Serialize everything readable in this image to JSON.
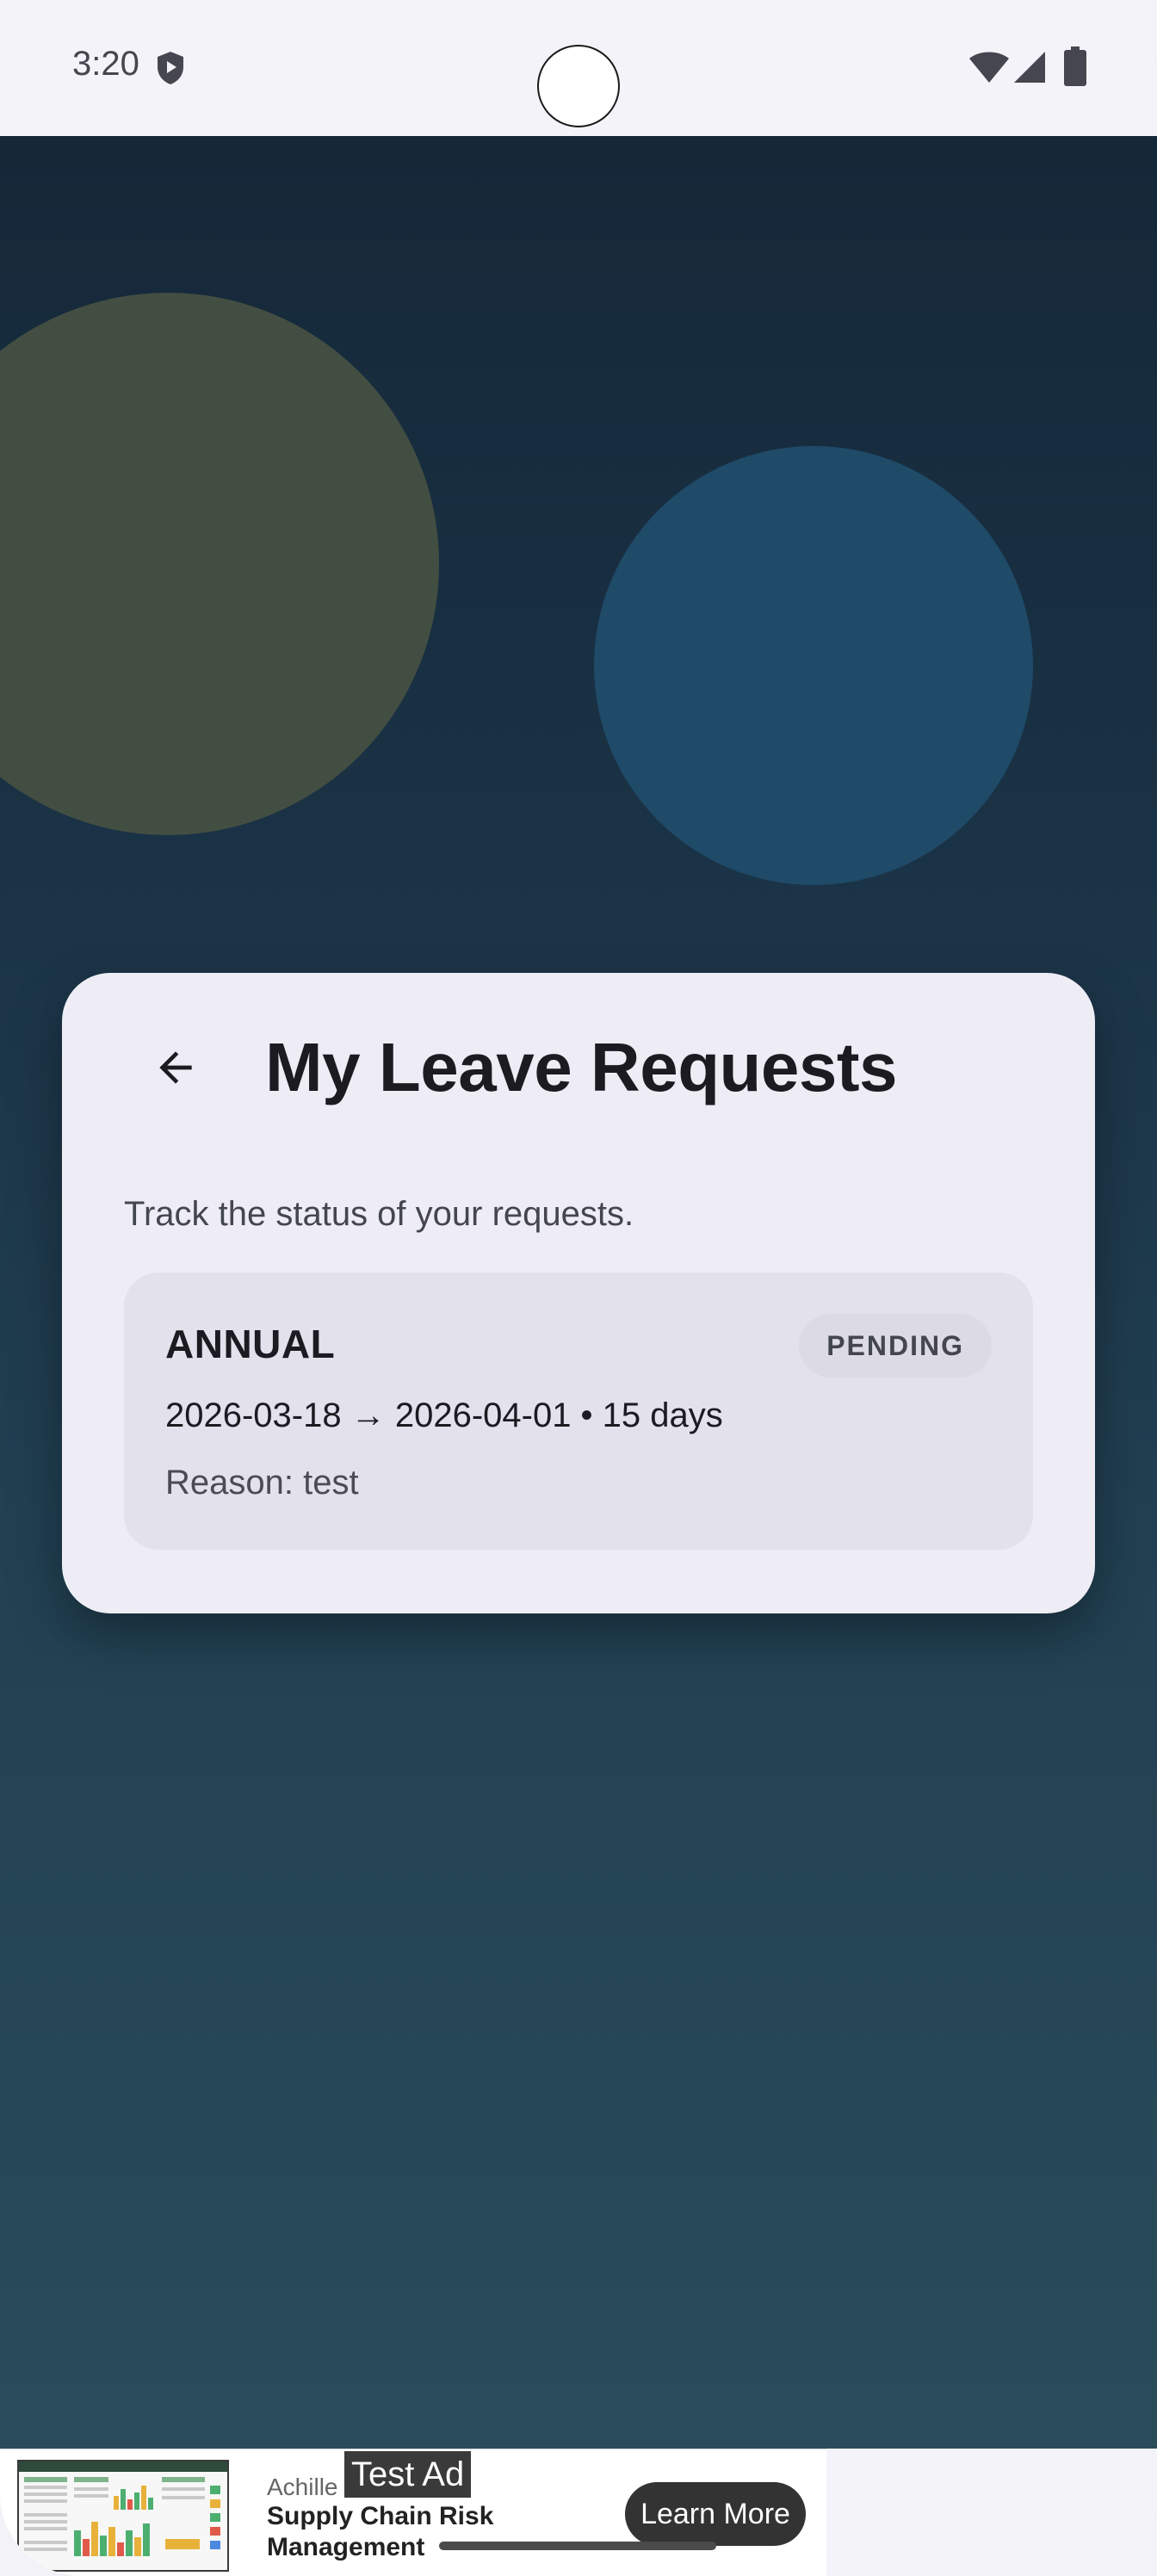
{
  "status_bar": {
    "time": "3:20"
  },
  "screen": {
    "title": "My Leave Requests",
    "subtitle": "Track the status of your requests.",
    "back_icon": "arrow-back-icon"
  },
  "requests": [
    {
      "type": "ANNUAL",
      "status": "PENDING",
      "dates": "2026-03-18 → 2026-04-01 • 15 days",
      "reason": "Reason: test"
    }
  ],
  "ad": {
    "advertiser": "Achille",
    "test_tag": "Test Ad",
    "headline": "Supply Chain Risk Management",
    "cta": "Learn More"
  },
  "colors": {
    "background_top": "#152838",
    "background_bottom": "#2a4c5a",
    "card": "#eeedf5",
    "request_card": "#e3e2ec",
    "blob_olive": "#434e42",
    "blob_blue": "#1f4a68"
  }
}
